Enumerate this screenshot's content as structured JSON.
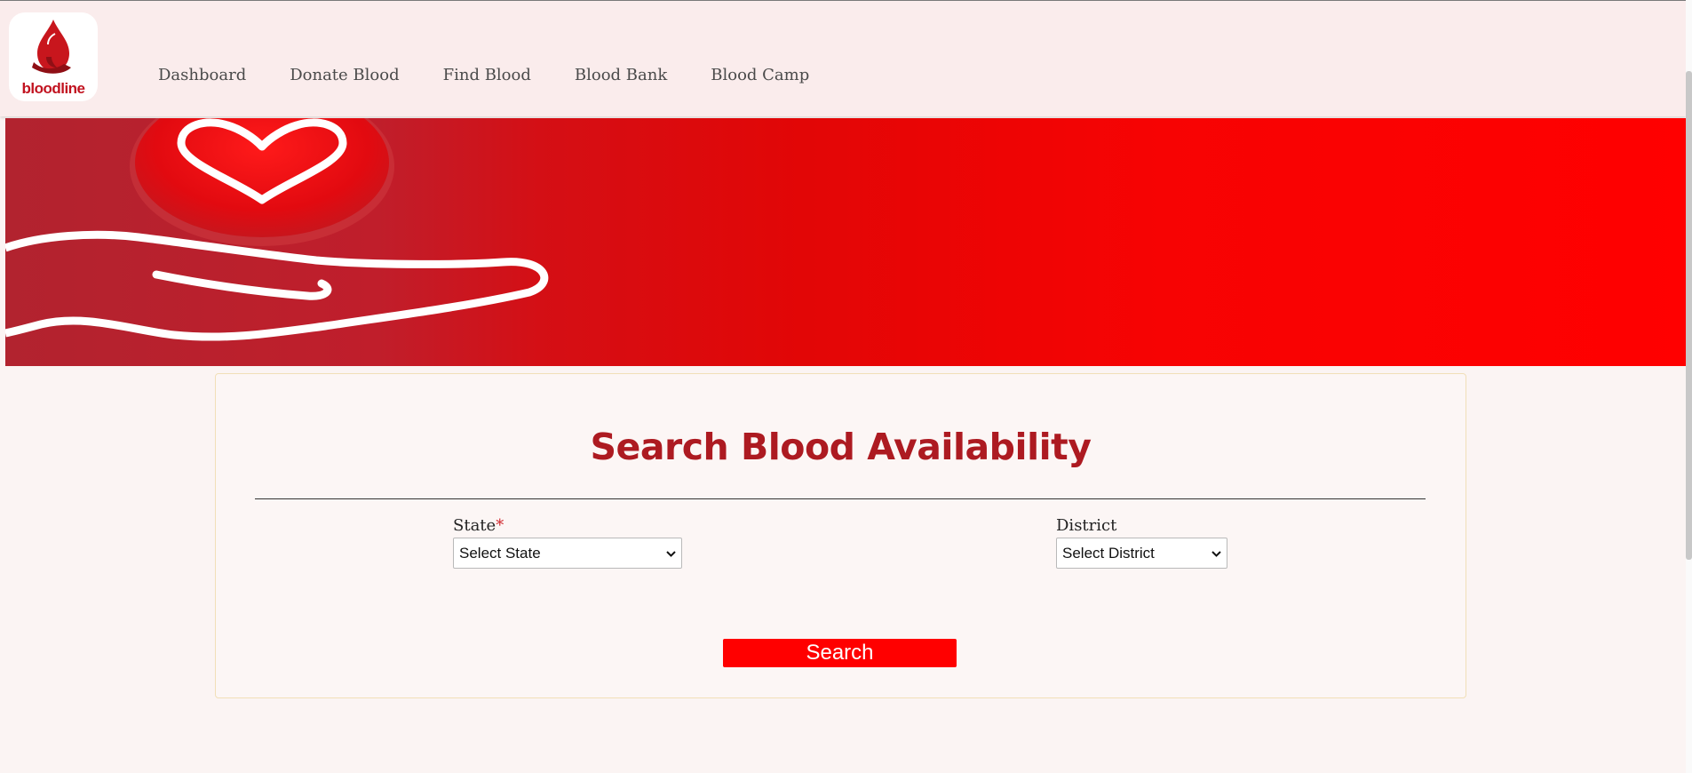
{
  "brand": {
    "logo_text": "bloodline"
  },
  "nav": {
    "items": [
      "Dashboard",
      "Donate Blood",
      "Find Blood",
      "Blood Bank",
      "Blood Camp"
    ]
  },
  "search_form": {
    "title": "Search Blood Availability",
    "state_label": "State",
    "state_required_mark": "*",
    "state_selected": "Select State",
    "district_label": "District",
    "district_selected": "Select District",
    "search_label": "Search"
  },
  "colors": {
    "brand_red": "#ff0000",
    "title_red": "#ad1a21",
    "navbar_bg": "#faecec",
    "page_bg": "#fbf4f3"
  },
  "icons": {
    "logo": "blood-drop-hand-icon",
    "banner": "heart-drop-on-hand-icon",
    "select_chevron": "chevron-down-icon"
  }
}
